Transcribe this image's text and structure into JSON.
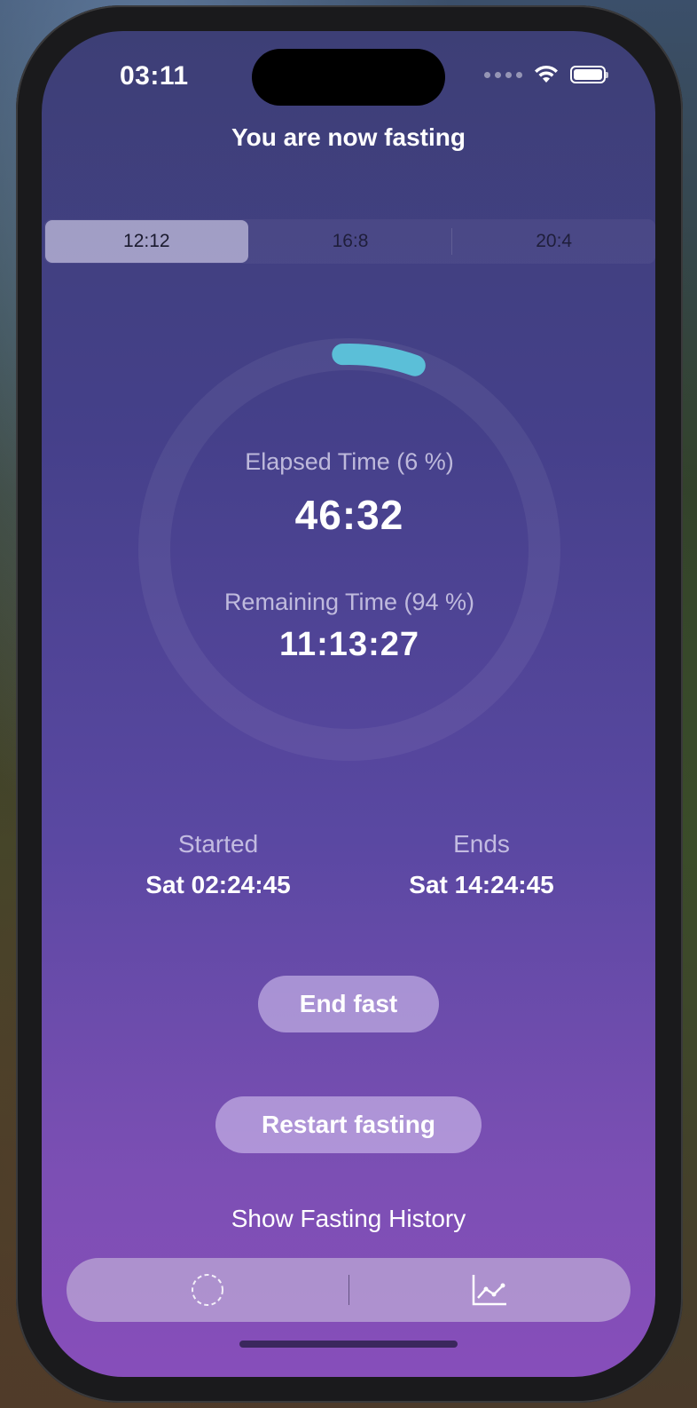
{
  "status_bar": {
    "time": "03:11"
  },
  "header": {
    "title": "You are now fasting"
  },
  "plans": {
    "selected_index": 0,
    "options": [
      "12:12",
      "16:8",
      "20:4"
    ]
  },
  "progress": {
    "elapsed_label": "Elapsed Time (6 %)",
    "elapsed_value": "46:32",
    "remaining_label": "Remaining Time (94 %)",
    "remaining_value": "11:13:27",
    "fraction": 0.06,
    "ring_color": "#5bbfd8",
    "track_color": "rgba(255,255,255,0.06)"
  },
  "schedule": {
    "started_label": "Started",
    "started_value": "Sat 02:24:45",
    "ends_label": "Ends",
    "ends_value": "Sat 14:24:45"
  },
  "actions": {
    "end_fast_label": "End fast",
    "restart_label": "Restart fasting",
    "history_label": "Show Fasting History"
  },
  "tabbar": {
    "tabs": [
      {
        "icon": "timer-ring-icon"
      },
      {
        "icon": "chart-line-icon"
      }
    ]
  }
}
